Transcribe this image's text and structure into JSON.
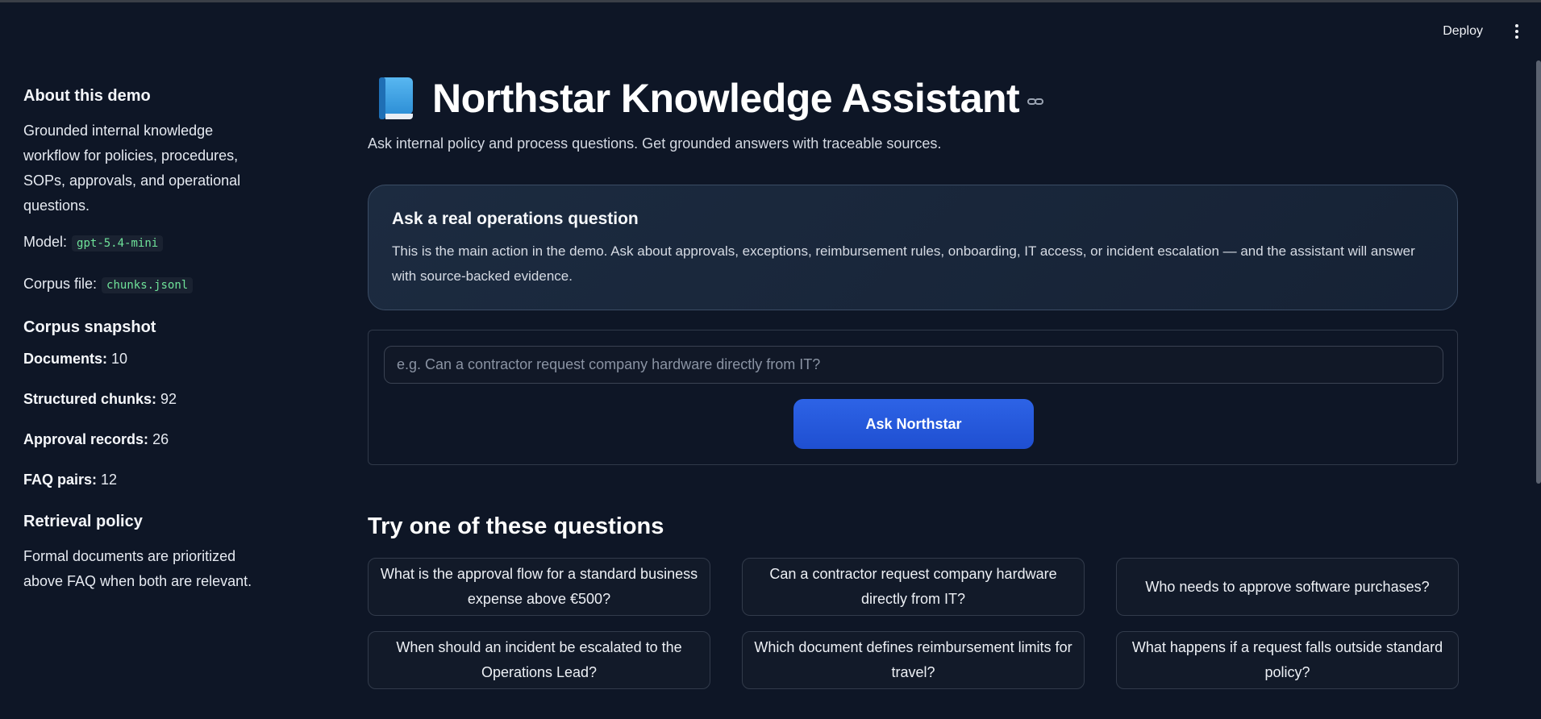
{
  "header": {
    "deploy_label": "Deploy"
  },
  "sidebar": {
    "about_heading": "About this demo",
    "about_text": "Grounded internal knowledge workflow for policies, procedures, SOPs, approvals, and operational questions.",
    "model_label": "Model:",
    "model_value": "gpt-5.4-mini",
    "corpus_label": "Corpus file:",
    "corpus_value": "chunks.jsonl",
    "snapshot_heading": "Corpus snapshot",
    "stats": [
      {
        "label": "Documents:",
        "value": "10"
      },
      {
        "label": "Structured chunks:",
        "value": "92"
      },
      {
        "label": "Approval records:",
        "value": "26"
      },
      {
        "label": "FAQ pairs:",
        "value": "12"
      }
    ],
    "retrieval_heading": "Retrieval policy",
    "retrieval_text": "Formal documents are prioritized above FAQ when both are relevant."
  },
  "main": {
    "title": "Northstar Knowledge Assistant",
    "title_icon": "book-icon",
    "subtitle": "Ask internal policy and process questions. Get grounded answers with traceable sources.",
    "hero": {
      "heading": "Ask a real operations question",
      "text": "This is the main action in the demo. Ask about approvals, exceptions, reimbursement rules, onboarding, IT access, or incident escalation — and the assistant will answer with source-backed evidence."
    },
    "ask": {
      "placeholder": "e.g. Can a contractor request company hardware directly from IT?",
      "value": "",
      "button_label": "Ask Northstar"
    },
    "try_heading": "Try one of these questions",
    "questions": [
      "What is the approval flow for a standard business expense above €500?",
      "Can a contractor request company hardware directly from IT?",
      "Who needs to approve software purchases?",
      "When should an incident be escalated to the Operations Lead?",
      "Which document defines reimbursement limits for travel?",
      "What happens if a request falls outside standard policy?"
    ]
  },
  "colors": {
    "background": "#0e1626",
    "accent_button": "#2d63e6",
    "code_text": "#6fe39a"
  }
}
